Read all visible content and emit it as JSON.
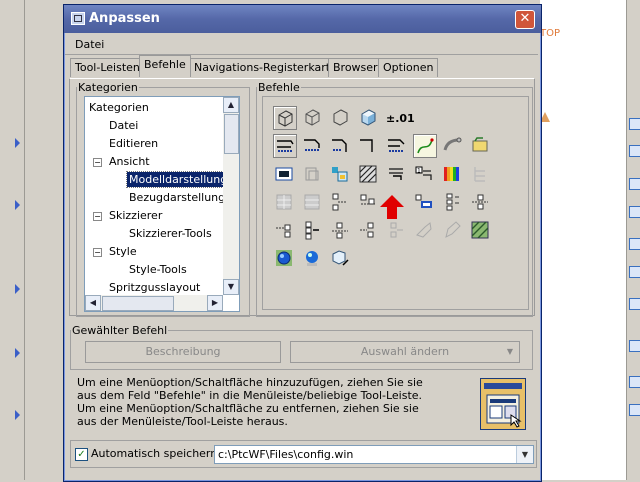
{
  "dialog": {
    "title": "Anpassen",
    "close": "✕"
  },
  "menu": {
    "datei": "Datei"
  },
  "tabs": [
    "Tool-Leisten",
    "Befehle",
    "Navigations-Registerkarten",
    "Browser",
    "Optionen"
  ],
  "kategorien": {
    "legend": "Kategorien",
    "items": [
      "Kategorien",
      "Datei",
      "Editieren",
      "Ansicht",
      "Modelldarstellung",
      "Bezugdarstellung",
      "Skizzierer",
      "Skizzierer-Tools",
      "Style",
      "Style-Tools",
      "Spritzgusslayout"
    ],
    "selected": "Modelldarstellung"
  },
  "befehle": {
    "legend": "Befehle",
    "pm_label": "±.01"
  },
  "gewaehlter": {
    "legend": "Gewählter Befehl",
    "beschreibung": "Beschreibung",
    "auswahl": "Auswahl ändern"
  },
  "hint": [
    "Um eine Menüoption/Schaltfläche hinzuzufügen, ziehen Sie sie",
    "aus dem Feld \"Befehle\" in die Menüleiste/beliebige Tool-Leiste.",
    "Um eine Menüoption/Schaltfläche zu entfernen, ziehen Sie sie",
    "aus der Menüleiste/Tool-Leiste heraus."
  ],
  "autosave": {
    "label": "Automatisch speichern in",
    "checked": true,
    "path": "c:\\PtcWF\\Files\\config.win"
  },
  "background": {
    "top_text": "TOP"
  },
  "colors": {
    "title_bar": "#5568a8",
    "selection": "#0a246a",
    "red_arrow": "#e00000"
  }
}
